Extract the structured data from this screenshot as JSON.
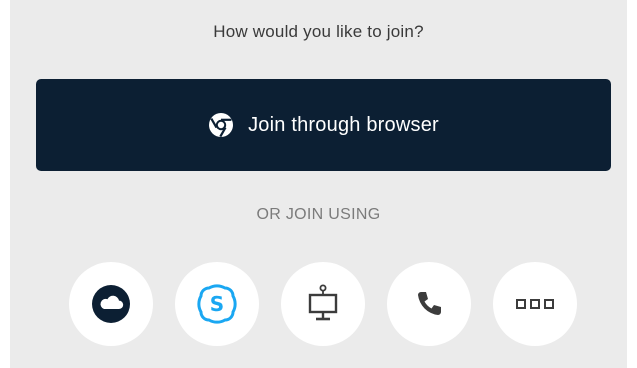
{
  "prompt": "How would you like to join?",
  "browser_button": {
    "label": "Join through browser",
    "icon": "chrome-icon",
    "background": "#0c1f33"
  },
  "divider_label": "OR JOIN USING",
  "join_options": [
    {
      "icon": "cloud-icon",
      "color": "#0c1f33"
    },
    {
      "icon": "skype-icon",
      "color": "#1aa7f2"
    },
    {
      "icon": "room-system-icon",
      "color": "#3c3c3c"
    },
    {
      "icon": "phone-icon",
      "color": "#3c3c3c"
    },
    {
      "icon": "more-icon",
      "color": "#3c3c3c"
    }
  ]
}
